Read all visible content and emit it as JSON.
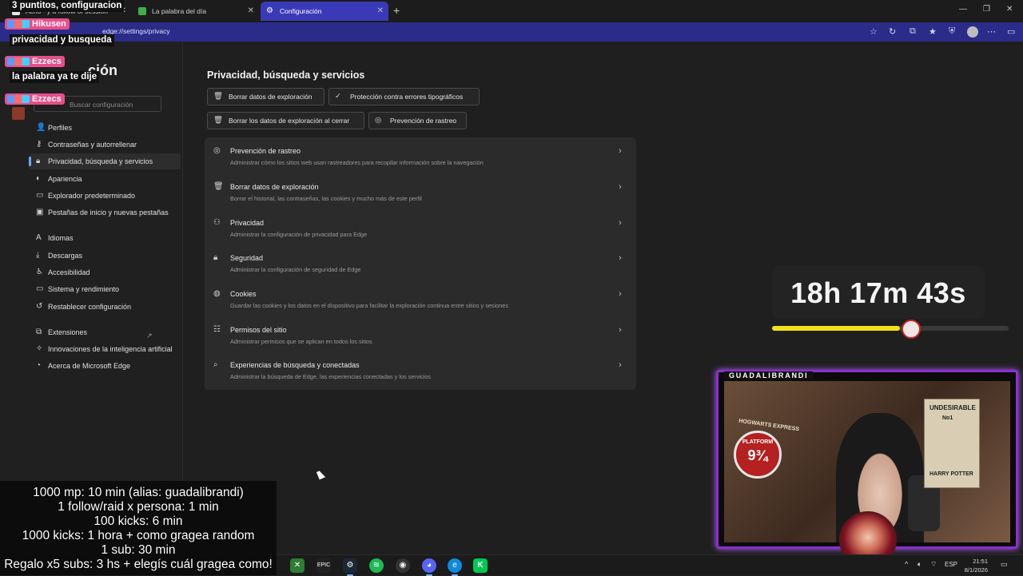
{
  "browser": {
    "tabs": [
      {
        "label": "Acho - y a follow of session"
      },
      {
        "label": "La palabra del día"
      },
      {
        "label": "Configuración"
      }
    ],
    "address": "edge://settings/privacy"
  },
  "sidebar": {
    "title": "ción",
    "search_placeholder": "Buscar configuración",
    "items": [
      {
        "label": "Perfiles",
        "icon": "person-icon"
      },
      {
        "label": "Contraseñas y autorrellenar",
        "icon": "key-icon"
      },
      {
        "label": "Privacidad, búsqueda y servicios",
        "icon": "lock-icon",
        "selected": true
      },
      {
        "label": "Apariencia",
        "icon": "palette-icon"
      },
      {
        "label": "Explorador predeterminado",
        "icon": "browser-icon"
      },
      {
        "label": "Pestañas de inicio y nuevas pestañas",
        "icon": "tabs-icon"
      },
      {
        "label": "Idiomas",
        "icon": "language-icon"
      },
      {
        "label": "Descargas",
        "icon": "download-icon"
      },
      {
        "label": "Accesibilidad",
        "icon": "accessibility-icon"
      },
      {
        "label": "Sistema y rendimiento",
        "icon": "laptop-icon"
      },
      {
        "label": "Restablecer configuración",
        "icon": "reset-icon"
      },
      {
        "label": "Extensiones",
        "icon": "extensions-icon"
      },
      {
        "label": "Innovaciones de la inteligencia artificial",
        "icon": "ai-icon"
      },
      {
        "label": "Acerca de Microsoft Edge",
        "icon": "edge-icon"
      }
    ]
  },
  "main": {
    "title": "Privacidad, búsqueda y servicios",
    "chips": [
      {
        "label": "Borrar datos de exploración",
        "icon": "trash-icon"
      },
      {
        "label": "Protección contra errores tipográficos",
        "icon": "spellcheck-icon"
      },
      {
        "label": "Borrar los datos de exploración al cerrar",
        "icon": "trash-clock-icon"
      },
      {
        "label": "Prevención de rastreo",
        "icon": "tracking-icon"
      }
    ],
    "rows": [
      {
        "title": "Prevención de rastreo",
        "desc": "Administrar cómo los sitios web usan rastreadores para recopilar información sobre la navegación",
        "icon": "tracking-icon"
      },
      {
        "title": "Borrar datos de exploración",
        "desc": "Borrar el historial, las contraseñas, las cookies y mucho más de este perfil",
        "icon": "trash-icon"
      },
      {
        "title": "Privacidad",
        "desc": "Administrar la configuración de privacidad para Edge",
        "icon": "privacy-icon"
      },
      {
        "title": "Seguridad",
        "desc": "Administrar la configuración de seguridad de Edge",
        "icon": "lock-icon"
      },
      {
        "title": "Cookies",
        "desc": "Guardar las cookies y los datos en el dispositivo para facilitar la exploración continua entre sitios y sesiones",
        "icon": "cookie-icon"
      },
      {
        "title": "Permisos del sitio",
        "desc": "Administrar permisos que se aplican en todos los sitios",
        "icon": "permissions-icon"
      },
      {
        "title": "Experiencias de búsqueda y conectadas",
        "desc": "Administrar la búsqueda de Edge, las experiencias conectadas y los servicios",
        "icon": "search-icon"
      }
    ]
  },
  "stream": {
    "timer": "18h 17m 43s",
    "timer_progress": 0.54,
    "cam_name": "GUADALIBRANDI",
    "poster_lines": [
      "UNDESIRABLE",
      "No1",
      "HARRY POTTER"
    ],
    "sign_lines": [
      "PLATFORM",
      "9¾"
    ],
    "hogwarts": "HOGWARTS EXPRESS",
    "goals": [
      "1000 mp: 10 min (alias: guadalibrandi)",
      "1 follow/raid x persona: 1 min",
      "100 kicks: 6 min",
      "1000 kicks: 1 hora + como gragea random",
      "1 sub: 30 min",
      "Regalo x5 subs: 3 hs + elegís cuál gragea como!"
    ],
    "chat": [
      {
        "type": "msg",
        "text": "3 puntitos, configuracion"
      },
      {
        "type": "user",
        "text": "Hikusen"
      },
      {
        "type": "msg",
        "text": "privacidad y busqueda"
      },
      {
        "type": "user",
        "text": "Ezzecs"
      },
      {
        "type": "msg",
        "text": "la palabra ya te dije"
      },
      {
        "type": "user",
        "text": "Ezzecs"
      }
    ]
  },
  "taskbar": {
    "lang": "ESP",
    "time": "21:51",
    "date": "8/1/2026"
  }
}
